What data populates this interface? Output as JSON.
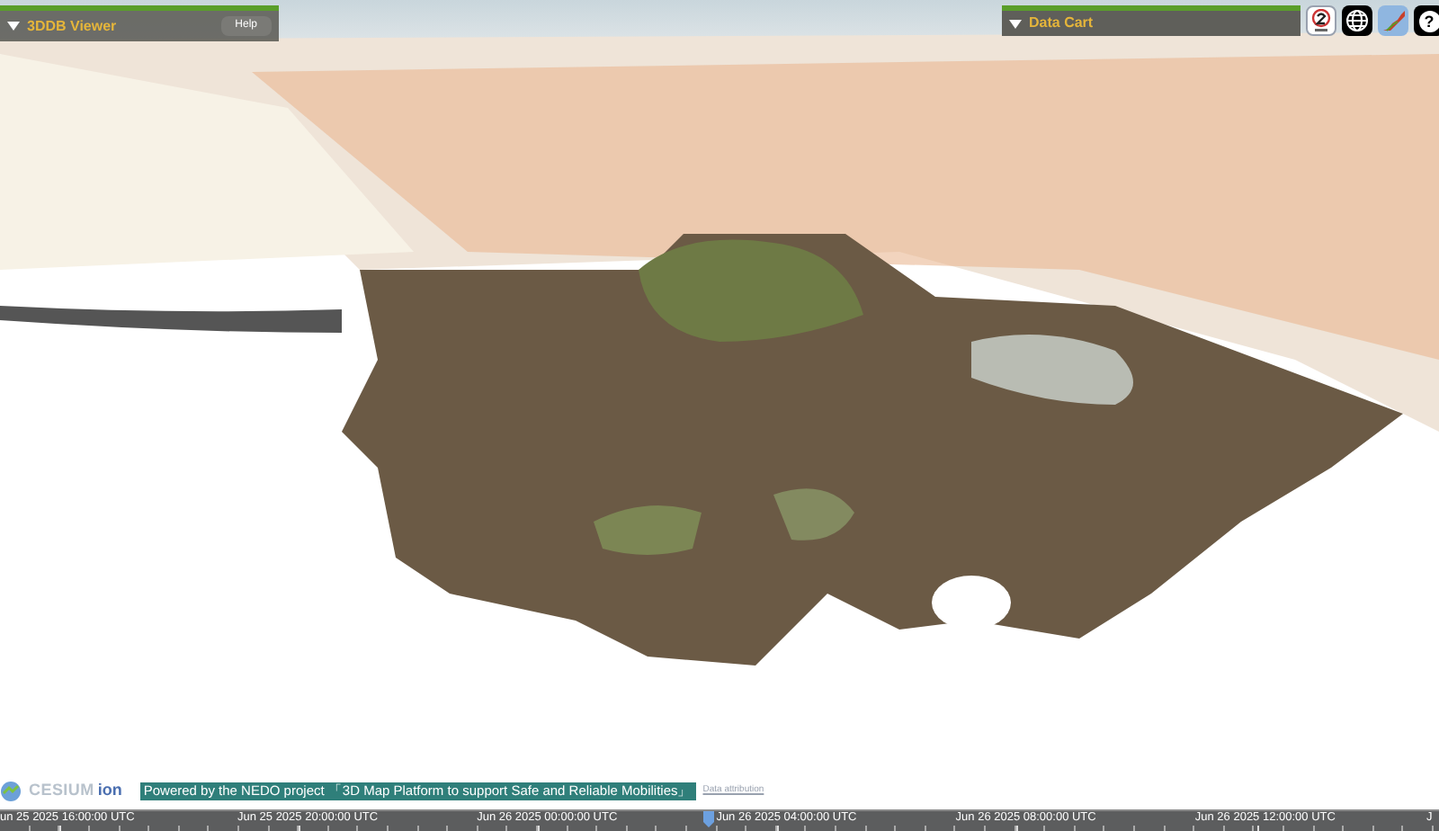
{
  "viewer_panel": {
    "title": "3DDB Viewer",
    "help_button": "Help",
    "expanded": false
  },
  "data_cart_panel": {
    "title": "Data Cart",
    "expanded": false
  },
  "toolbar": {
    "help_button": "?"
  },
  "credits": {
    "logo_word": "CESIUM",
    "logo_suffix": "ion",
    "banner": "Powered by the NEDO project 「3D Map Platform to support Safe and Reliable Mobilities」",
    "attribution_link": "Data attribution"
  },
  "timeline": {
    "labels": [
      "un 25 2025 16:00:00 UTC",
      "Jun 25 2025 20:00:00 UTC",
      "Jun 26 2025 00:00:00 UTC",
      "Jun 26 2025 04:00:00 UTC",
      "Jun 26 2025 08:00:00 UTC",
      "Jun 26 2025 12:00:00 UTC",
      "J"
    ]
  }
}
